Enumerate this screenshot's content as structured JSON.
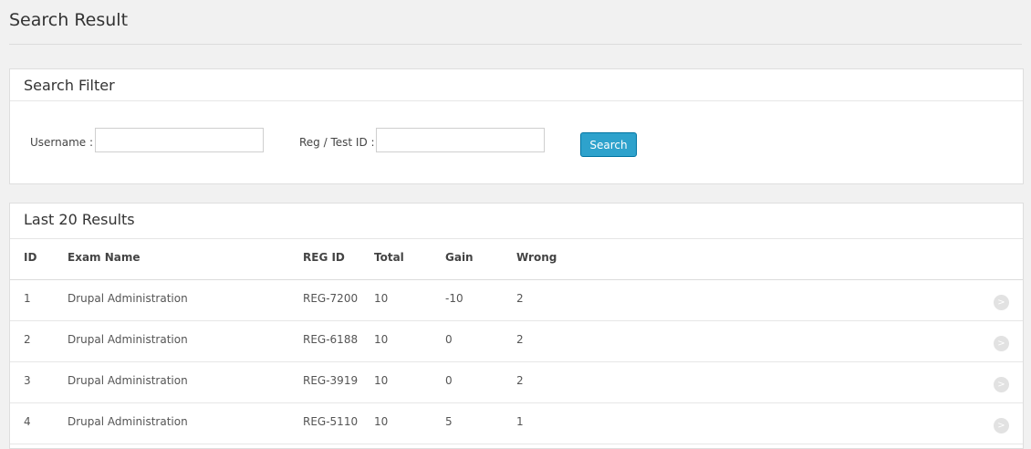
{
  "page": {
    "title": "Search Result"
  },
  "filter": {
    "title": "Search Filter",
    "username_label": "Username :",
    "username_value": "",
    "regid_label": "Reg / Test ID :",
    "regid_value": "",
    "search_button": "Search"
  },
  "results": {
    "title": "Last 20 Results",
    "columns": [
      "ID",
      "Exam Name",
      "REG ID",
      "Total",
      "Gain",
      "Wrong"
    ],
    "rows": [
      {
        "id": "1",
        "exam": "Drupal Administration",
        "reg": "REG-7200",
        "total": "10",
        "gain": "-10",
        "wrong": "2",
        "action_icon": "circle-arrow-right-icon"
      },
      {
        "id": "2",
        "exam": "Drupal Administration",
        "reg": "REG-6188",
        "total": "10",
        "gain": "0",
        "wrong": "2",
        "action_icon": "circle-arrow-right-icon"
      },
      {
        "id": "3",
        "exam": "Drupal Administration",
        "reg": "REG-3919",
        "total": "10",
        "gain": "0",
        "wrong": "2",
        "action_icon": "circle-arrow-right-icon"
      },
      {
        "id": "4",
        "exam": "Drupal Administration",
        "reg": "REG-5110",
        "total": "10",
        "gain": "5",
        "wrong": "1",
        "action_icon": "circle-arrow-right-icon"
      }
    ]
  },
  "colors": {
    "background": "#f1f1f1",
    "panel": "#ffffff",
    "button": "#2ea2cc"
  }
}
